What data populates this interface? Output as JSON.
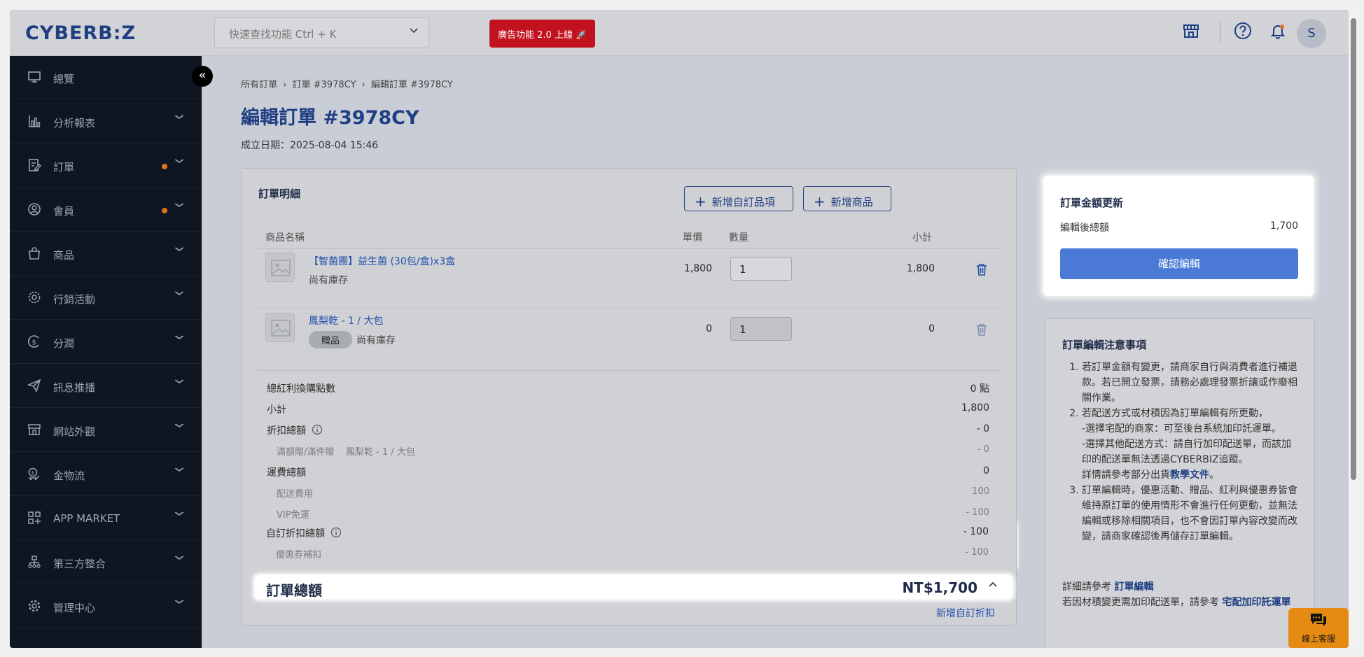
{
  "header": {
    "logo": "CYBERB:Z",
    "search_placeholder": "快速查找功能 Ctrl + K",
    "ad_badge": "廣告功能 2.0 上線 🚀",
    "avatar_letter": "S"
  },
  "sidebar": {
    "items": [
      {
        "label": "總覽",
        "icon": "monitor-icon",
        "dot": false,
        "arrow": false
      },
      {
        "label": "分析報表",
        "icon": "bar-chart-icon",
        "dot": false,
        "arrow": true
      },
      {
        "label": "訂單",
        "icon": "order-edit-icon",
        "dot": true,
        "arrow": true
      },
      {
        "label": "會員",
        "icon": "user-circle-icon",
        "dot": true,
        "arrow": true
      },
      {
        "label": "商品",
        "icon": "shopping-bag-icon",
        "dot": false,
        "arrow": true
      },
      {
        "label": "行銷活動",
        "icon": "marketing-gear-icon",
        "dot": false,
        "arrow": true
      },
      {
        "label": "分潤",
        "icon": "dollar-circle-icon",
        "dot": false,
        "arrow": true
      },
      {
        "label": "訊息推播",
        "icon": "send-icon",
        "dot": false,
        "arrow": true
      },
      {
        "label": "網站外觀",
        "icon": "storefront-icon",
        "dot": false,
        "arrow": true
      },
      {
        "label": "金物流",
        "icon": "delivery-icon",
        "dot": false,
        "arrow": true
      },
      {
        "label": "APP MARKET",
        "icon": "app-grid-icon",
        "dot": false,
        "arrow": true
      },
      {
        "label": "第三方整合",
        "icon": "integration-icon",
        "dot": false,
        "arrow": true
      },
      {
        "label": "管理中心",
        "icon": "settings-icon",
        "dot": false,
        "arrow": true
      }
    ]
  },
  "breadcrumb": [
    "所有訂單",
    "訂單 #3978CY",
    "編輯訂單 #3978CY"
  ],
  "page": {
    "title": "編輯訂單 #3978CY",
    "created": "成立日期：2025-08-04 15:46"
  },
  "order": {
    "title": "訂單明細",
    "add_custom_item": "新增自訂品項",
    "add_product": "新增商品",
    "columns": {
      "name": "商品名稱",
      "price": "單價",
      "qty": "數量",
      "subtotal": "小計"
    },
    "items": [
      {
        "name": "【智菌團】益生菌 (30包/盒)x3盒",
        "gift": "",
        "stock": "尚有庫存",
        "price": "1,800",
        "qty": "1",
        "subtotal": "1,800"
      },
      {
        "name": "鳳梨乾 - 1 / 大包",
        "gift": "贈品",
        "stock": "尚有庫存",
        "price": "0",
        "qty": "1",
        "subtotal": "0"
      }
    ],
    "summary": {
      "points_label": "總紅利換購點數",
      "points_value": "0 點",
      "subtotal_label": "小計",
      "subtotal_value": "1,800",
      "discount_label": "折扣總額",
      "discount_value": "- 0",
      "discount_sub_label": "滿額贈/滿件贈",
      "discount_sub_item": "鳳梨乾 - 1 / 大包",
      "discount_sub_value": "- 0",
      "shipping_label": "運費總額",
      "shipping_value": "0",
      "ship_fee_label": "配送費用",
      "ship_fee_value": "100",
      "vip_label": "VIP免運",
      "vip_value": "- 100",
      "custom_discount_label": "自訂折扣總額",
      "custom_discount_value": "- 100",
      "coupon_label": "優惠券補扣",
      "coupon_value": "- 100"
    },
    "total_label": "訂單總額",
    "total_value": "NT$1,700",
    "add_custom_discount": "新增自訂折扣"
  },
  "update": {
    "title": "訂單金額更新",
    "edited_total_label": "編輯後總額",
    "edited_total_value": "1,700",
    "confirm": "確認編輯"
  },
  "notes": {
    "title": "訂單編輯注意事項",
    "n1": "若訂單金額有變更，請商家自行與消費者進行補退款。若已開立發票，請務必處理發票折讓或作廢相關作業。",
    "n2_main": "若配送方式或材積因為訂單編輯有所更動，",
    "n2_a": "-選擇宅配的商家：可至後台系統加印託運單。",
    "n2_b": "-選擇其他配送方式：請自行加印配送單，而該加印的配送單無法透過CYBERBIZ追蹤。",
    "n2_c_pre": "詳情請參考部分出貨",
    "n2_c_link": "教學文件",
    "n2_c_post": "。",
    "n3": "訂單編輯時，優惠活動、贈品、紅利與優惠券皆會維持原訂單的使用情形不會進行任何更動，並無法編輯或移除相關項目，也不會因訂單內容改變而改變，請商家確認後再儲存訂單編輯。",
    "ref1_pre": "詳細請參考 ",
    "ref1_link": "訂單編輯",
    "ref2_pre": "若因材積變更需加印配送單，請參考 ",
    "ref2_link": "宅配加印託運單"
  },
  "chat": {
    "label": "線上客服"
  },
  "colors": {
    "brand": "#1f3e83",
    "primary_button": "#4a7ad6",
    "ad_red": "#c2121f",
    "chat_orange": "#e58a12",
    "badge_dot": "#e0731c"
  }
}
